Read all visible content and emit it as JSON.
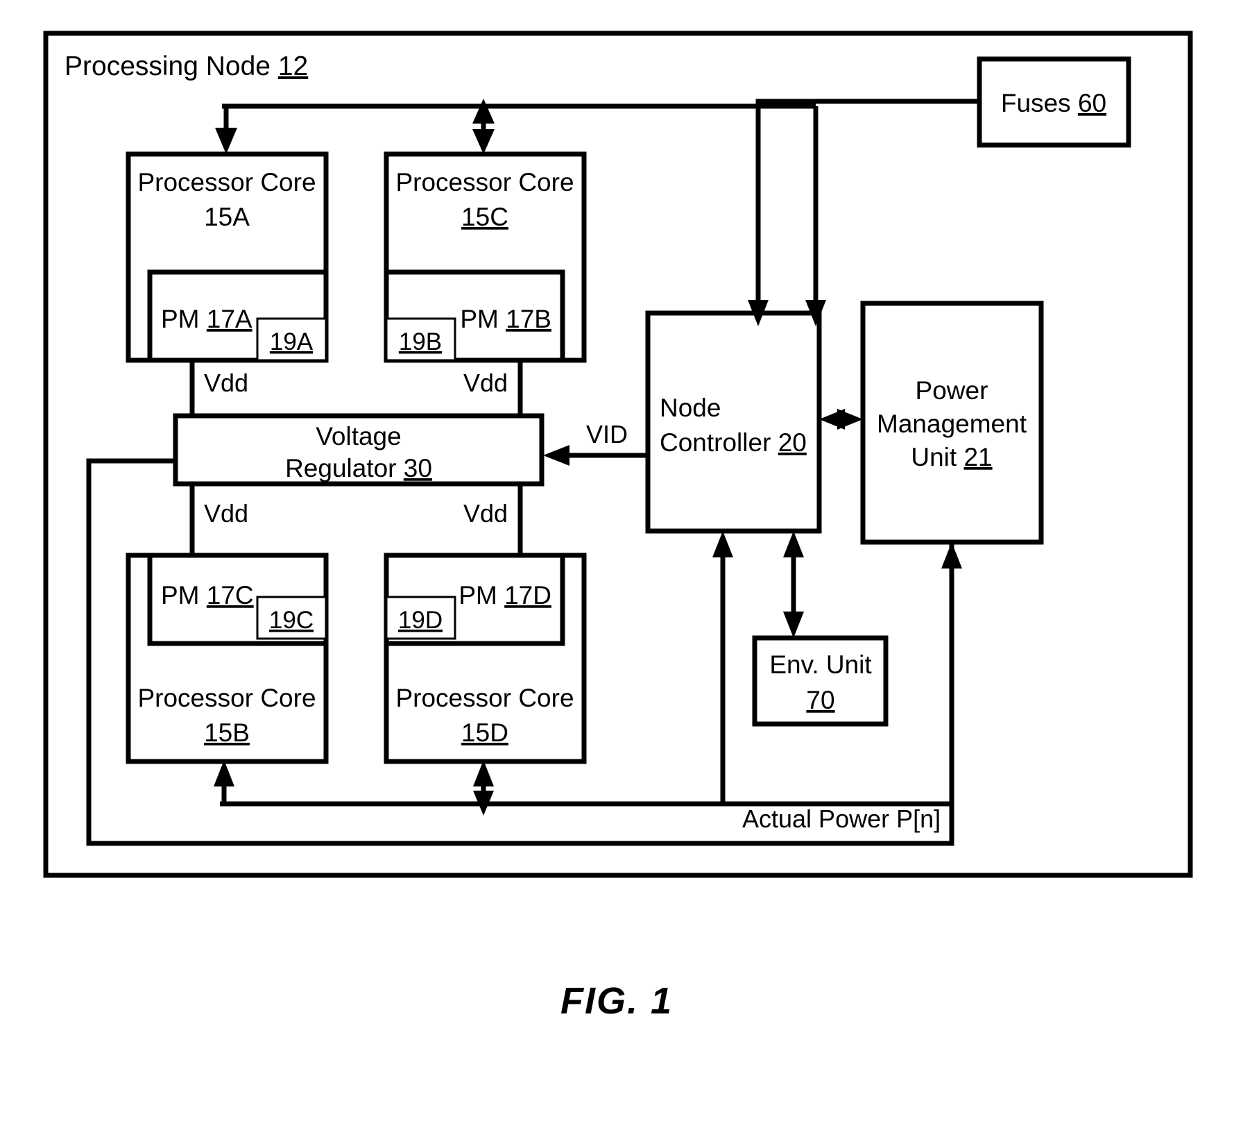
{
  "figure": {
    "caption": "FIG. 1",
    "outer_block": {
      "title_text": "Processing Node ",
      "title_ref": "12"
    }
  },
  "blocks": {
    "core_15a": {
      "line1": "Processor Core",
      "ref": "15A"
    },
    "core_15c": {
      "line1": "Processor Core",
      "ref": "15C"
    },
    "core_15b": {
      "line1": "Processor Core",
      "ref": "15B"
    },
    "core_15d": {
      "line1": "Processor Core",
      "ref": "15D"
    },
    "pm_17a": {
      "label": "PM ",
      "ref": "17A"
    },
    "pm_17b": {
      "label": "PM ",
      "ref": "17B"
    },
    "pm_17c": {
      "label": "PM ",
      "ref": "17C"
    },
    "pm_17d": {
      "label": "PM ",
      "ref": "17D"
    },
    "reg_19a": {
      "ref": "19A"
    },
    "reg_19b": {
      "ref": "19B"
    },
    "reg_19c": {
      "ref": "19C"
    },
    "reg_19d": {
      "ref": "19D"
    },
    "voltage_regulator": {
      "line1": "Voltage",
      "line2": "Regulator ",
      "ref": "30"
    },
    "node_controller": {
      "line1": "Node",
      "line2": "Controller ",
      "ref": "20"
    },
    "power_management_unit": {
      "line1": "Power",
      "line2": "Management",
      "line3": "Unit ",
      "ref": "21"
    },
    "fuses": {
      "label": "Fuses ",
      "ref": "60"
    },
    "env_unit": {
      "line1": "Env. Unit",
      "ref": "70"
    }
  },
  "wire_labels": {
    "vdd_top_left": "Vdd",
    "vdd_top_right": "Vdd",
    "vdd_bottom_left": "Vdd",
    "vdd_bottom_right": "Vdd",
    "vid": "VID",
    "actual_power": "Actual Power P[n]"
  },
  "colors": {
    "stroke": "#000000",
    "background": "#ffffff"
  }
}
